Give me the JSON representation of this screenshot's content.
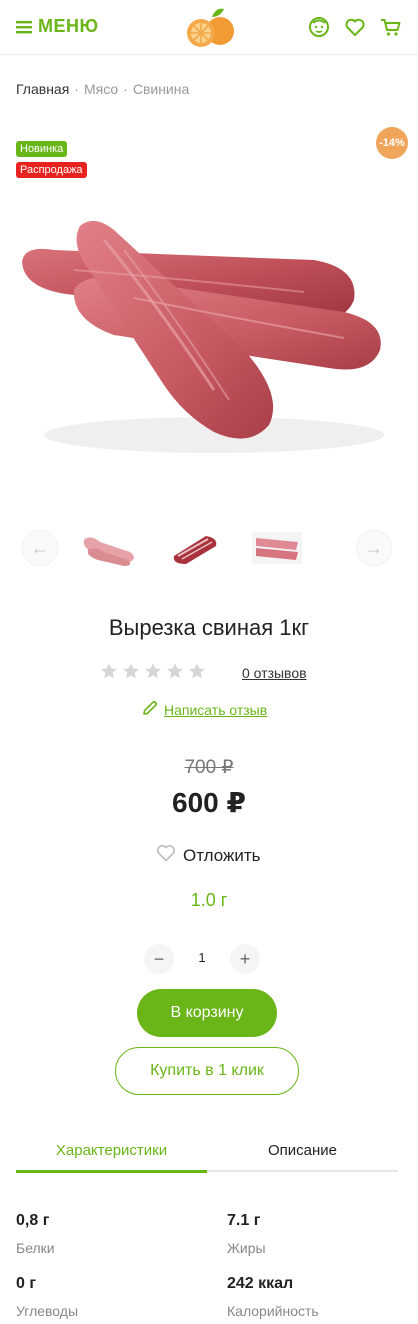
{
  "header": {
    "menu_label": "МЕНЮ",
    "accent_color": "#6ab517",
    "icons": [
      "menu-icon",
      "orange-logo-icon",
      "user-face-icon",
      "heart-icon",
      "cart-icon"
    ]
  },
  "breadcrumb": [
    "Главная",
    "Мясо",
    "Свинина"
  ],
  "badges": {
    "new": "Новинка",
    "sale": "Распродажа",
    "discount": "-14%"
  },
  "product": {
    "title": "Вырезка свиная 1кг",
    "rating_stars": 0,
    "rating_max": 5,
    "reviews": "0 отзывов",
    "write_review": "Написать отзыв",
    "old_price": "700 ₽",
    "price": "600 ₽",
    "postpone": "Отложить",
    "weight": "1.0 г",
    "quantity": "1",
    "add_to_cart": "В корзину",
    "buy_one_click": "Купить в 1 клик"
  },
  "tabs": [
    {
      "label": "Характеристики",
      "active": true
    },
    {
      "label": "Описание",
      "active": false
    }
  ],
  "specs": [
    {
      "value": "0,8 г",
      "label": "Белки"
    },
    {
      "value": "7.1 г",
      "label": "Жиры"
    },
    {
      "value": "0 г",
      "label": "Углеводы"
    },
    {
      "value": "242 ккал",
      "label": "Калорийность"
    }
  ]
}
